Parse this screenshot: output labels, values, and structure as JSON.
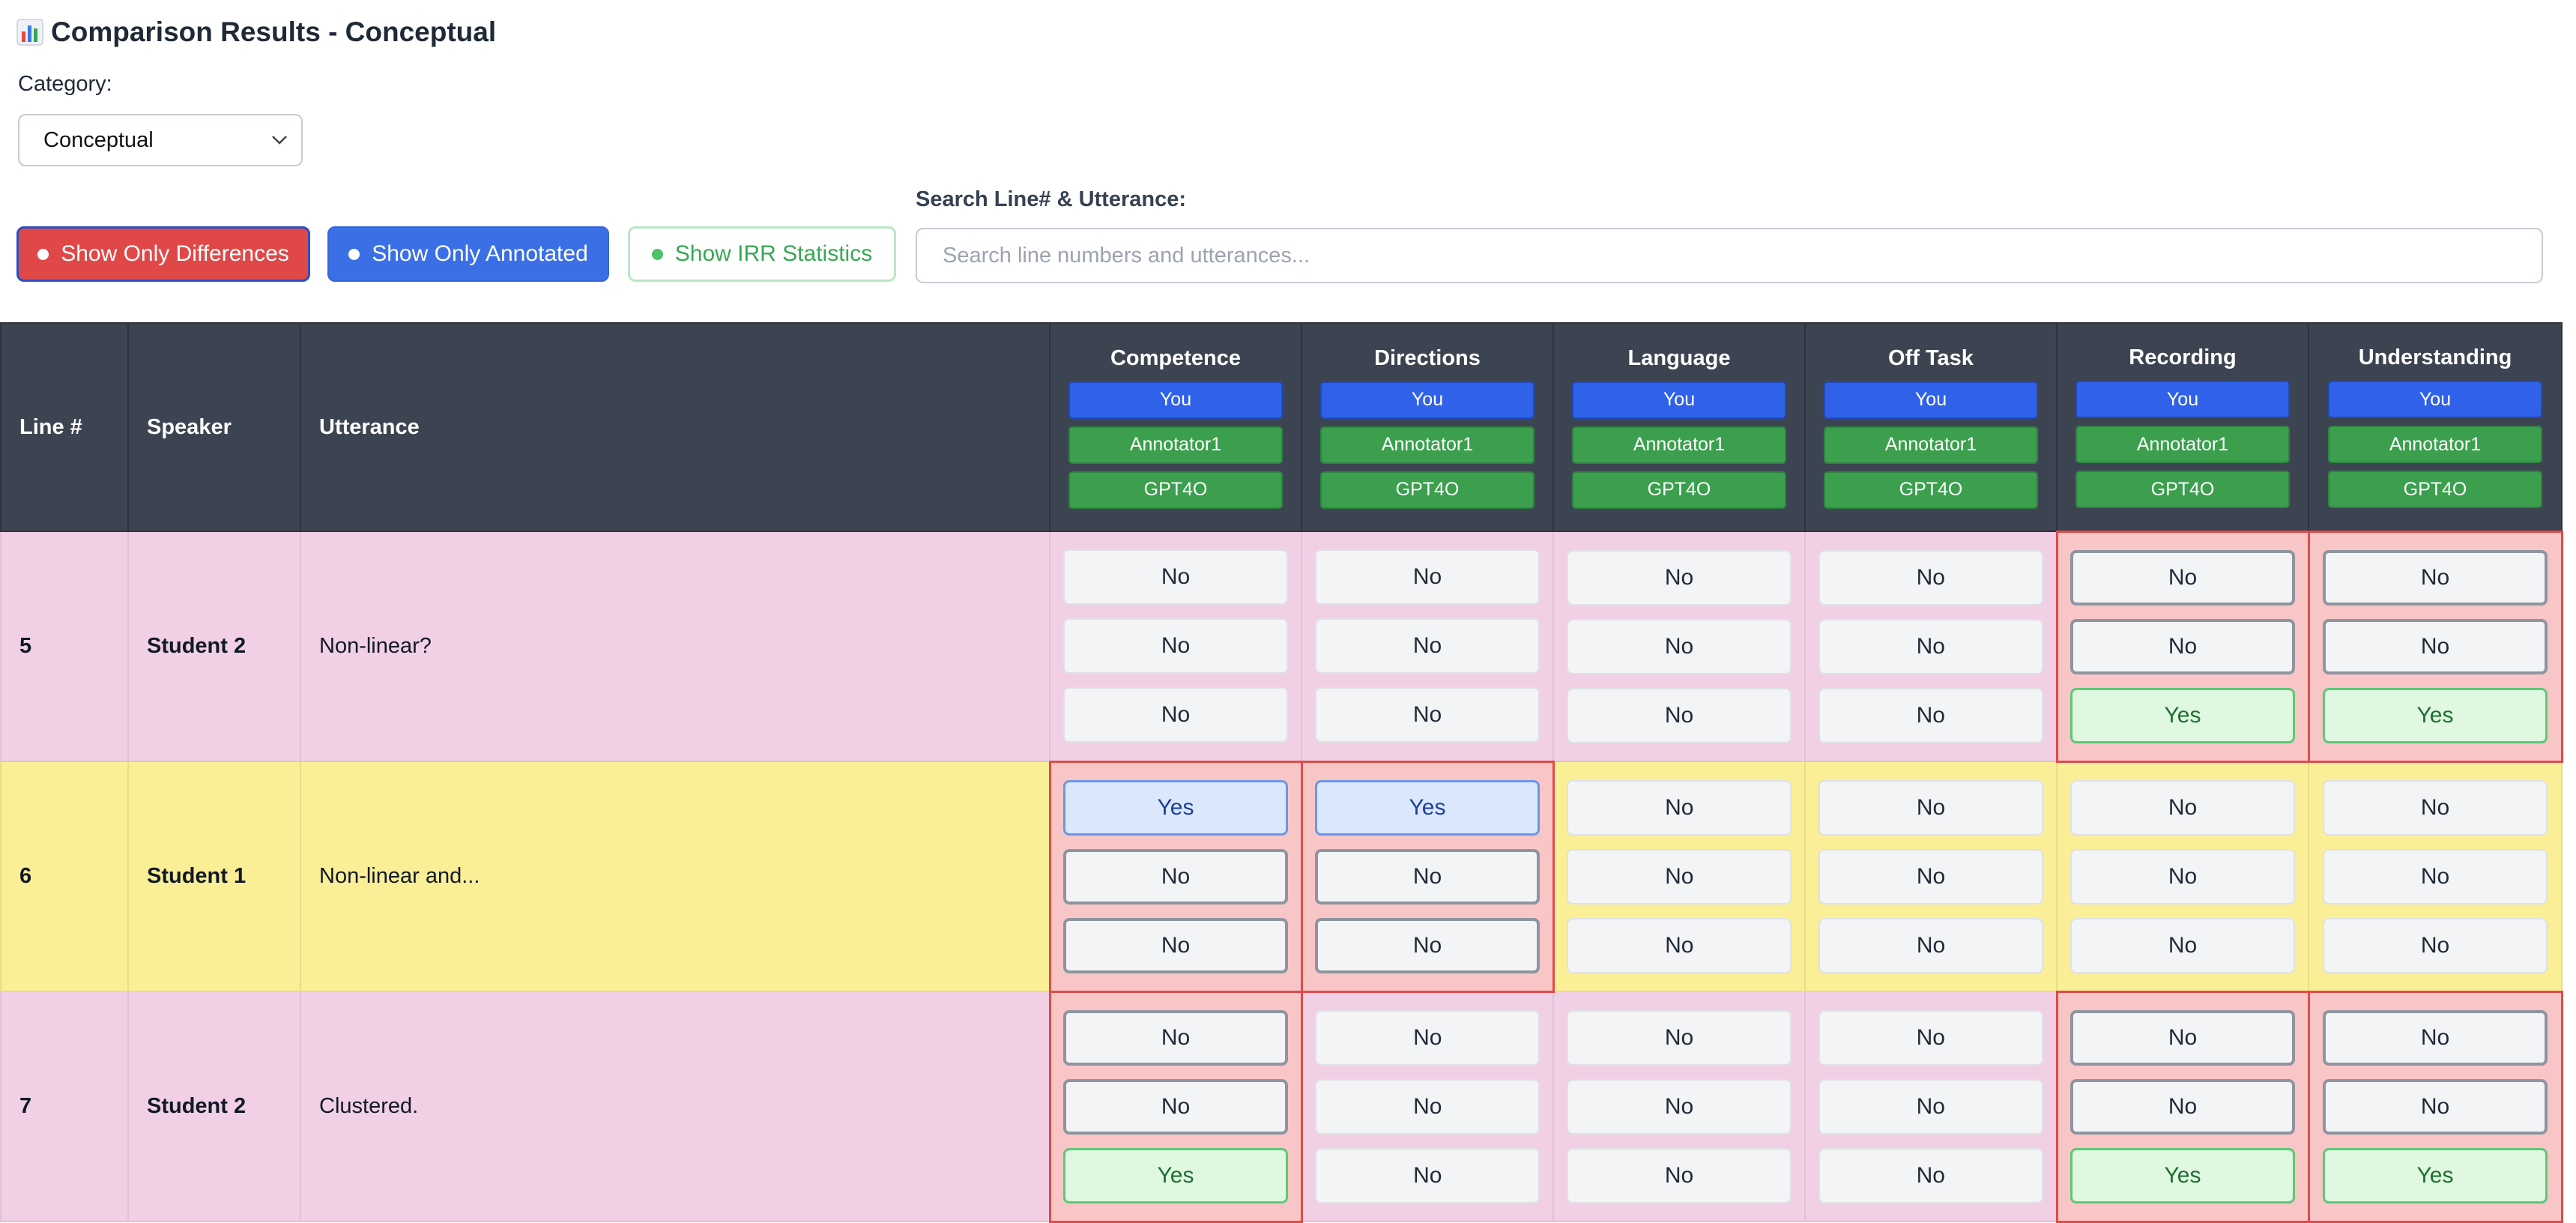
{
  "page": {
    "title": "Comparison Results - Conceptual"
  },
  "category": {
    "label": "Category:",
    "selected": "Conceptual"
  },
  "filters": {
    "show_differences": "Show Only Differences",
    "show_annotated": "Show Only Annotated",
    "show_irr": "Show IRR Statistics"
  },
  "search": {
    "label": "Search Line# & Utterance:",
    "placeholder": "Search line numbers and utterances..."
  },
  "table": {
    "headers": {
      "line": "Line #",
      "speaker": "Speaker",
      "utterance": "Utterance"
    },
    "annotators": [
      "You",
      "Annotator1",
      "GPT4O"
    ],
    "codes": [
      "Competence",
      "Directions",
      "Language",
      "Off Task",
      "Recording",
      "Understanding"
    ],
    "rows": [
      {
        "line": "5",
        "speaker": "Student 2",
        "utterance": "Non-linear?",
        "cells": [
          [
            "No",
            "No",
            "No"
          ],
          [
            "No",
            "No",
            "No"
          ],
          [
            "No",
            "No",
            "No"
          ],
          [
            "No",
            "No",
            "No"
          ],
          [
            "No",
            "No",
            "Yes"
          ],
          [
            "No",
            "No",
            "Yes"
          ]
        ]
      },
      {
        "line": "6",
        "speaker": "Student 1",
        "utterance": "Non-linear and...",
        "cells": [
          [
            "Yes",
            "No",
            "No"
          ],
          [
            "Yes",
            "No",
            "No"
          ],
          [
            "No",
            "No",
            "No"
          ],
          [
            "No",
            "No",
            "No"
          ],
          [
            "No",
            "No",
            "No"
          ],
          [
            "No",
            "No",
            "No"
          ]
        ]
      },
      {
        "line": "7",
        "speaker": "Student 2",
        "utterance": "Clustered.",
        "cells": [
          [
            "No",
            "No",
            "Yes"
          ],
          [
            "No",
            "No",
            "No"
          ],
          [
            "No",
            "No",
            "No"
          ],
          [
            "No",
            "No",
            "No"
          ],
          [
            "No",
            "No",
            "Yes"
          ],
          [
            "No",
            "No",
            "Yes"
          ]
        ]
      }
    ]
  },
  "colors": {
    "accent_red": "#e04848",
    "accent_blue": "#3b6fe6",
    "accent_green": "#3b9f4e",
    "row_pink": "#f1d0e6",
    "row_yellow": "#faee96"
  }
}
